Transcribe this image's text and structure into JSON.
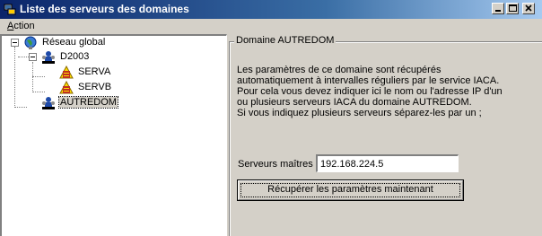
{
  "window": {
    "title": "Liste des serveurs des domaines",
    "icons": {
      "app": "network-app-icon",
      "minimize": "minimize-icon",
      "maximize": "maximize-icon",
      "close": "close-icon"
    }
  },
  "menu": {
    "action_label": "Action",
    "action_accel": "A",
    "action_rest": "ction"
  },
  "tree": {
    "root": {
      "label": "Réseau global",
      "icon": "globe-network-icon"
    },
    "domain1": {
      "label": "D2003",
      "icon": "domain-users-icon"
    },
    "server1": {
      "label": "SERVA",
      "icon": "server-warning-icon"
    },
    "server2": {
      "label": "SERVB",
      "icon": "server-warning-icon"
    },
    "domain2": {
      "label": "AUTREDOM",
      "icon": "domain-users-icon",
      "selected": true
    }
  },
  "panel": {
    "group_title": "Domaine AUTREDOM",
    "description": [
      "Les paramètres de ce domaine sont récupérés",
      "automatiquement à intervalles réguliers par le service IACA.",
      "Pour cela vous devez indiquer ici le nom ou l'adresse IP d'un",
      "ou plusieurs serveurs IACA du domaine AUTREDOM.",
      "Si vous indiquez plusieurs serveurs séparez-les par un ;"
    ],
    "masters_label": "Serveurs maîtres",
    "masters_value": "192.168.224.5",
    "fetch_button": "Récupérer les paramètres maintenant"
  }
}
